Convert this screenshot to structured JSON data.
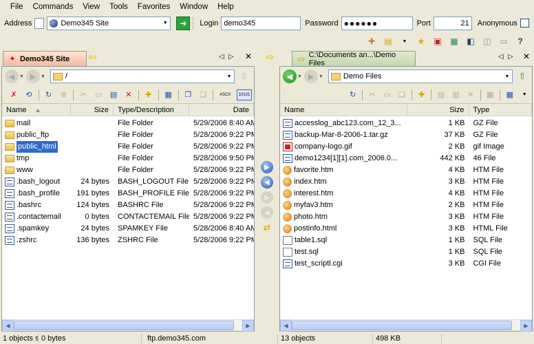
{
  "menu": [
    "File",
    "Commands",
    "View",
    "Tools",
    "Favorites",
    "Window",
    "Help"
  ],
  "address": {
    "label": "Address",
    "site": "Demo345 Site",
    "login_label": "Login",
    "login_value": "demo345",
    "password_label": "Password",
    "password_mask": "●●●●●●",
    "port_label": "Port",
    "port_value": "21",
    "anonymous_label": "Anonymous"
  },
  "tabs": {
    "left": "Demo345 Site",
    "right": "C:\\Documents an...\\Demo Files"
  },
  "left_pane": {
    "path": "/",
    "columns": [
      "Name",
      "Size",
      "Type/Description",
      "Date"
    ],
    "rows": [
      {
        "name": "mail",
        "size": "",
        "type": "File Folder",
        "date": "5/29/2006 8:40 AM",
        "icon": "folder"
      },
      {
        "name": "public_ftp",
        "size": "",
        "type": "File Folder",
        "date": "5/28/2006 9:22 PM",
        "icon": "folder"
      },
      {
        "name": "public_html",
        "size": "",
        "type": "File Folder",
        "date": "5/28/2006 9:22 PM",
        "icon": "folder",
        "selected": true
      },
      {
        "name": "tmp",
        "size": "",
        "type": "File Folder",
        "date": "5/28/2006 9:50 PM",
        "icon": "folder"
      },
      {
        "name": "www",
        "size": "",
        "type": "File Folder",
        "date": "5/28/2006 9:22 PM",
        "icon": "folder"
      },
      {
        "name": ".bash_logout",
        "size": "24 bytes",
        "type": "BASH_LOGOUT File",
        "date": "5/28/2006 9:22 PM",
        "icon": "doc"
      },
      {
        "name": ".bash_profile",
        "size": "191 bytes",
        "type": "BASH_PROFILE File",
        "date": "5/28/2006 9:22 PM",
        "icon": "doc"
      },
      {
        "name": ".bashrc",
        "size": "124 bytes",
        "type": "BASHRC File",
        "date": "5/28/2006 9:22 PM",
        "icon": "doc"
      },
      {
        "name": ".contactemail",
        "size": "0 bytes",
        "type": "CONTACTEMAIL File",
        "date": "5/28/2006 9:22 PM",
        "icon": "doc"
      },
      {
        "name": ".spamkey",
        "size": "24 bytes",
        "type": "SPAMKEY File",
        "date": "5/28/2006 8:40 AM",
        "icon": "doc"
      },
      {
        "name": ".zshrc",
        "size": "136 bytes",
        "type": "ZSHRC File",
        "date": "5/28/2006 9:22 PM",
        "icon": "doc"
      }
    ]
  },
  "right_pane": {
    "path": "Demo Files",
    "columns": [
      "Name",
      "Size",
      "Type"
    ],
    "rows": [
      {
        "name": "accesslog_abc123.com_12_3...",
        "size": "1 KB",
        "type": "GZ File",
        "icon": "doc"
      },
      {
        "name": "backup-Mar-8-2006-1.tar.gz",
        "size": "37 KB",
        "type": "GZ File",
        "icon": "doc"
      },
      {
        "name": "company-logo.gif",
        "size": "2 KB",
        "type": "gif Image",
        "icon": "gif"
      },
      {
        "name": "demo1234[1][1].com_2006.0...",
        "size": "442 KB",
        "type": "46 File",
        "icon": "doc"
      },
      {
        "name": "favorite.htm",
        "size": "4 KB",
        "type": "HTM File",
        "icon": "web"
      },
      {
        "name": "index.htm",
        "size": "3 KB",
        "type": "HTM File",
        "icon": "web"
      },
      {
        "name": "interest.htm",
        "size": "4 KB",
        "type": "HTM File",
        "icon": "web"
      },
      {
        "name": "myfav3.htm",
        "size": "2 KB",
        "type": "HTM File",
        "icon": "web"
      },
      {
        "name": "photo.htm",
        "size": "3 KB",
        "type": "HTM File",
        "icon": "web"
      },
      {
        "name": "postinfo.html",
        "size": "3 KB",
        "type": "HTML File",
        "icon": "web"
      },
      {
        "name": "table1.sql",
        "size": "1 KB",
        "type": "SQL File",
        "icon": "sql"
      },
      {
        "name": "test.sql",
        "size": "1 KB",
        "type": "SQL File",
        "icon": "sql"
      },
      {
        "name": "test_scriptl.cgi",
        "size": "3 KB",
        "type": "CGI File",
        "icon": "doc"
      }
    ]
  },
  "status": {
    "left_objects": "1 objects s",
    "left_bytes": "0 bytes",
    "host": "ftp.demo345.com",
    "right_objects": "13 objects",
    "right_size": "498 KB"
  }
}
